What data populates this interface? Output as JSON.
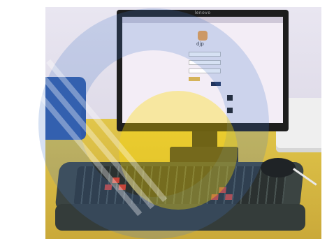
{
  "monitor": {
    "brand": "lenovo"
  },
  "screen": {
    "logo_text": "djp"
  },
  "colors": {
    "desk": "#d8bb45",
    "chair": "#2f5aa8",
    "keyboard": "#3b4442",
    "accent_keys": "#c8463a",
    "logo": "#f2a24a",
    "watermark_blue": "#4678c8",
    "watermark_yellow": "#ffdc00"
  }
}
